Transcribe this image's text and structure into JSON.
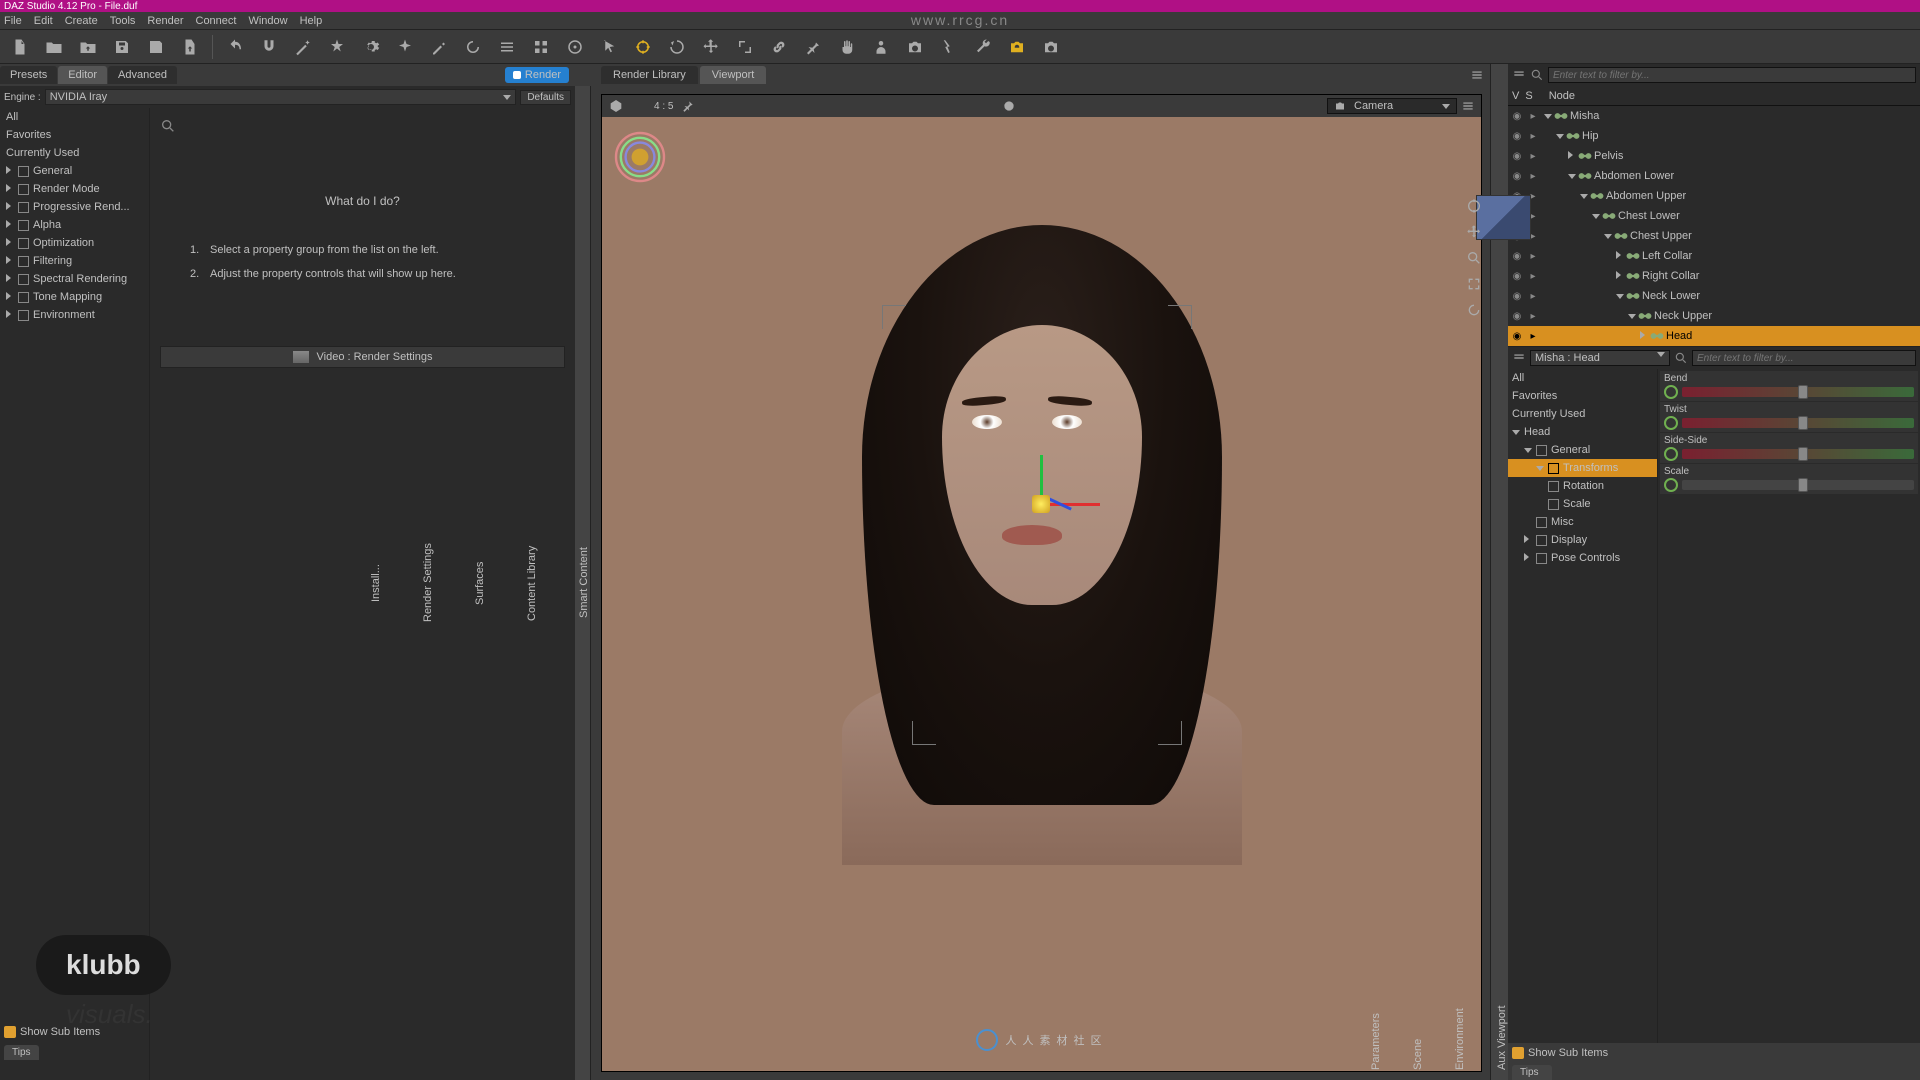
{
  "title": "DAZ Studio 4.12 Pro - File.duf",
  "watermark_url": "www.rrcg.cn",
  "menu": [
    "File",
    "Edit",
    "Create",
    "Tools",
    "Render",
    "Connect",
    "Window",
    "Help"
  ],
  "left": {
    "tabs": [
      "Presets",
      "Editor",
      "Advanced"
    ],
    "render_btn": "Render",
    "engine_label": "Engine :",
    "engine_value": "NVIDIA Iray",
    "defaults": "Defaults",
    "tree": [
      {
        "label": "All",
        "box": false
      },
      {
        "label": "Favorites",
        "box": false
      },
      {
        "label": "Currently Used",
        "box": false
      },
      {
        "label": "General",
        "box": true,
        "dim": true
      },
      {
        "label": "Render Mode",
        "box": true
      },
      {
        "label": "Progressive Rend...",
        "box": true,
        "dim": true
      },
      {
        "label": "Alpha",
        "box": true
      },
      {
        "label": "Optimization",
        "box": true
      },
      {
        "label": "Filtering",
        "box": true,
        "dim": true
      },
      {
        "label": "Spectral Rendering",
        "box": true
      },
      {
        "label": "Tone Mapping",
        "box": true
      },
      {
        "label": "Environment",
        "box": true
      }
    ],
    "help_title": "What do I do?",
    "help_1": "1.",
    "help_1_text": "Select a property group from the list on the left.",
    "help_2": "2.",
    "help_2_text": "Adjust the property controls that will show up here.",
    "video_btn": "Video : Render Settings",
    "show_sub": "Show Sub Items",
    "tips": "Tips"
  },
  "center": {
    "tabs": [
      "Render Library",
      "Viewport"
    ],
    "aspect": "4 : 5",
    "camera": "Camera",
    "footer_logo": "人人素材社区"
  },
  "logo": {
    "name": "klubb",
    "sub": "visuals."
  },
  "scene": {
    "filter_placeholder": "Enter text to filter by...",
    "header": "Node",
    "v": "V",
    "s": "S",
    "rows": [
      {
        "label": "Misha",
        "indent": 0,
        "arrow": "d"
      },
      {
        "label": "Hip",
        "indent": 1,
        "arrow": "d"
      },
      {
        "label": "Pelvis",
        "indent": 2,
        "arrow": "r"
      },
      {
        "label": "Abdomen Lower",
        "indent": 2,
        "arrow": "d"
      },
      {
        "label": "Abdomen Upper",
        "indent": 3,
        "arrow": "d"
      },
      {
        "label": "Chest Lower",
        "indent": 4,
        "arrow": "d"
      },
      {
        "label": "Chest Upper",
        "indent": 5,
        "arrow": "d"
      },
      {
        "label": "Left Collar",
        "indent": 6,
        "arrow": "r"
      },
      {
        "label": "Right Collar",
        "indent": 6,
        "arrow": "r"
      },
      {
        "label": "Neck Lower",
        "indent": 6,
        "arrow": "d"
      },
      {
        "label": "Neck Upper",
        "indent": 7,
        "arrow": "d"
      },
      {
        "label": "Head",
        "indent": 8,
        "arrow": "r",
        "selected": true
      }
    ]
  },
  "param": {
    "dd": "Misha : Head",
    "filter_placeholder": "Enter text to filter by...",
    "tree": [
      {
        "label": "All",
        "indent": 0
      },
      {
        "label": "Favorites",
        "indent": 0
      },
      {
        "label": "Currently Used",
        "indent": 0
      },
      {
        "label": "Head",
        "indent": 0,
        "dim": true,
        "arrow": "d"
      },
      {
        "label": "General",
        "indent": 1,
        "dim": true,
        "arrow": "d",
        "box": true
      },
      {
        "label": "Transforms",
        "indent": 2,
        "selected": true,
        "arrow": "d",
        "box": true
      },
      {
        "label": "Rotation",
        "indent": 3,
        "box": true
      },
      {
        "label": "Scale",
        "indent": 3,
        "box": true
      },
      {
        "label": "Misc",
        "indent": 2,
        "box": true
      },
      {
        "label": "Display",
        "indent": 1,
        "arrow": "r",
        "box": true
      },
      {
        "label": "Pose Controls",
        "indent": 1,
        "arrow": "r",
        "box": true,
        "dim": true
      }
    ],
    "sliders": [
      "Bend",
      "Twist",
      "Side-Side",
      "Scale"
    ],
    "show_sub": "Show Sub Items",
    "tips": "Tips"
  },
  "side_tabs_left": [
    "Smart Content",
    "Content Library",
    "Surfaces",
    "Render Settings",
    "Install..."
  ],
  "side_tabs_right": [
    "Aux Viewport",
    "Environment",
    "Scene",
    "Parameters"
  ]
}
